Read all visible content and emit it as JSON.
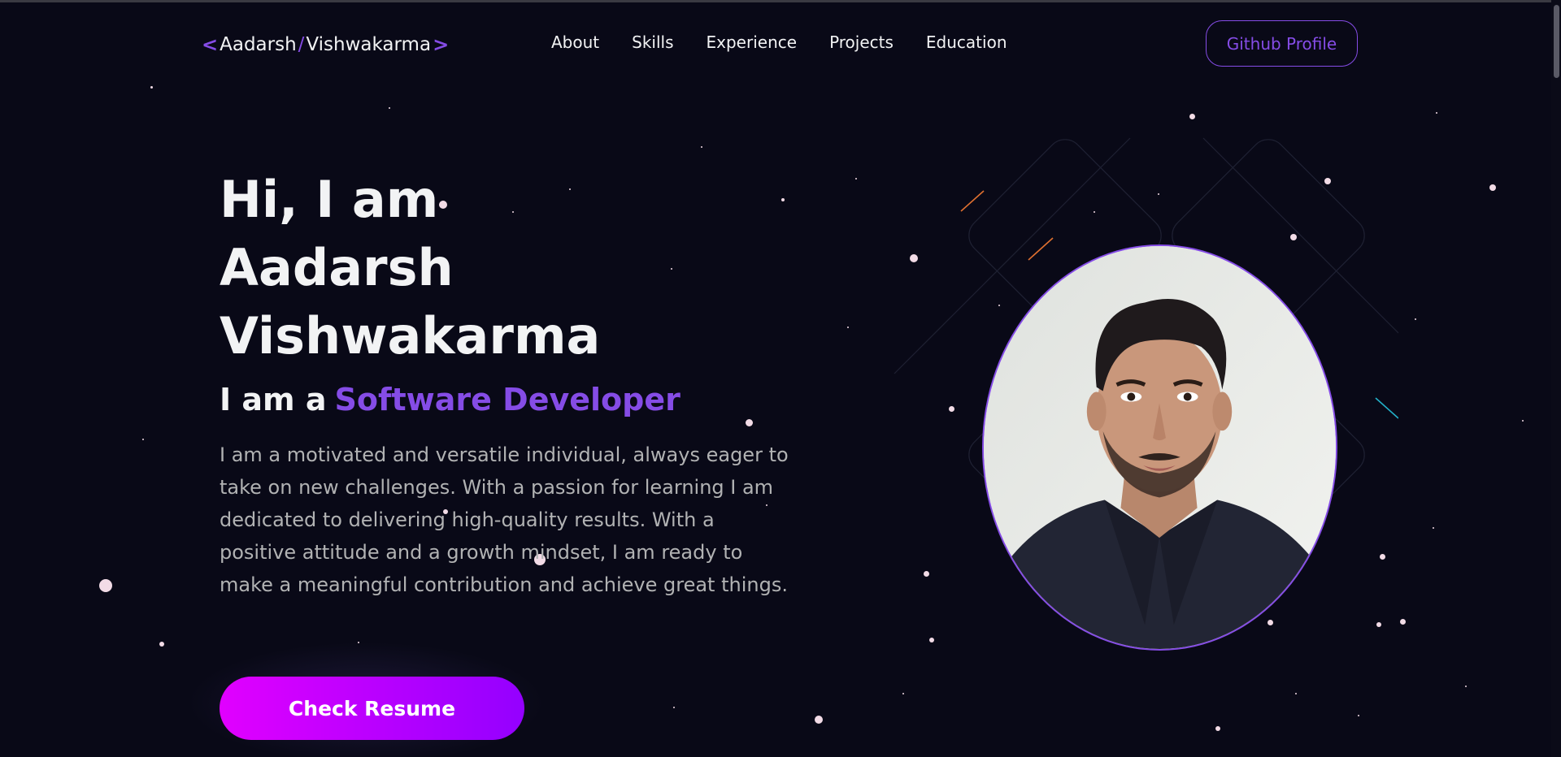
{
  "nav": {
    "logo": {
      "first": "Aadarsh",
      "slash": "/",
      "last": "Vishwakarma",
      "open": "<",
      "close": ">"
    },
    "links": [
      "About",
      "Skills",
      "Experience",
      "Projects",
      "Education"
    ],
    "github_label": "Github Profile"
  },
  "hero": {
    "title_line1": "Hi, I am",
    "title_line2": "Aadarsh",
    "title_line3": "Vishwakarma",
    "role_prefix": "I am a",
    "role_value": "Software Developer",
    "description": "I am a motivated and versatile individual, always eager to take on new challenges. With a passion for learning I am dedicated to delivering high-quality results. With a positive attitude and a growth mindset, I am ready to make a meaningful contribution and achieve great things.",
    "cta_label": "Check Resume"
  },
  "colors": {
    "background": "#090917",
    "accent": "#854ce6",
    "text_primary": "#f2f3f4",
    "text_secondary": "#b1b2b3",
    "cta_gradient_start": "#e100ff",
    "cta_gradient_end": "#9400ff"
  }
}
